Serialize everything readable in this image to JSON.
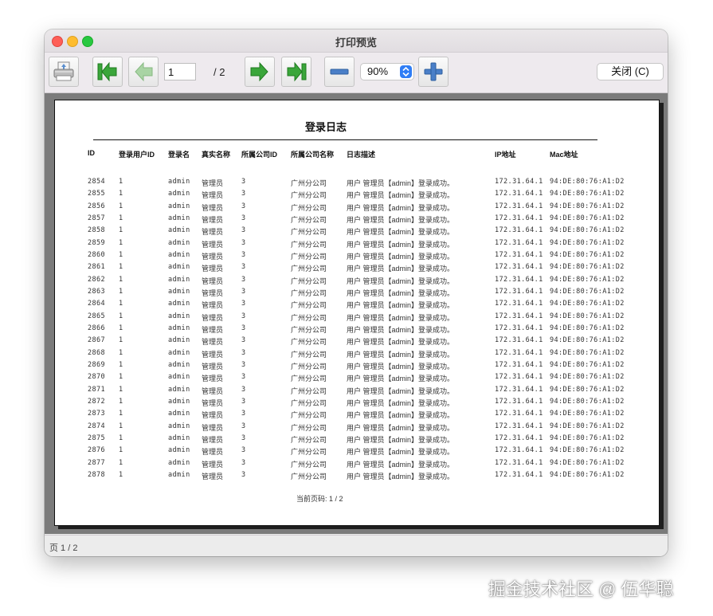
{
  "window": {
    "title": "打印预览"
  },
  "toolbar": {
    "page_value": "1",
    "page_total": "/ 2",
    "zoom_value": "90%",
    "close_label": "关闭 (C)"
  },
  "status": {
    "text": "页 1 / 2"
  },
  "document": {
    "title": "登录日志",
    "columns": [
      "ID",
      "登录用户ID",
      "登录名",
      "真实名称",
      "所属公司ID",
      "所属公司名称",
      "日志描述",
      "IP地址",
      "Mac地址"
    ],
    "rows": [
      [
        "2854",
        "1",
        "admin",
        "管理员",
        "3",
        "广州分公司",
        "用户 管理员【admin】登录成功。",
        "172.31.64.1",
        "94:DE:80:76:A1:D2"
      ],
      [
        "2855",
        "1",
        "admin",
        "管理员",
        "3",
        "广州分公司",
        "用户 管理员【admin】登录成功。",
        "172.31.64.1",
        "94:DE:80:76:A1:D2"
      ],
      [
        "2856",
        "1",
        "admin",
        "管理员",
        "3",
        "广州分公司",
        "用户 管理员【admin】登录成功。",
        "172.31.64.1",
        "94:DE:80:76:A1:D2"
      ],
      [
        "2857",
        "1",
        "admin",
        "管理员",
        "3",
        "广州分公司",
        "用户 管理员【admin】登录成功。",
        "172.31.64.1",
        "94:DE:80:76:A1:D2"
      ],
      [
        "2858",
        "1",
        "admin",
        "管理员",
        "3",
        "广州分公司",
        "用户 管理员【admin】登录成功。",
        "172.31.64.1",
        "94:DE:80:76:A1:D2"
      ],
      [
        "2859",
        "1",
        "admin",
        "管理员",
        "3",
        "广州分公司",
        "用户 管理员【admin】登录成功。",
        "172.31.64.1",
        "94:DE:80:76:A1:D2"
      ],
      [
        "2860",
        "1",
        "admin",
        "管理员",
        "3",
        "广州分公司",
        "用户 管理员【admin】登录成功。",
        "172.31.64.1",
        "94:DE:80:76:A1:D2"
      ],
      [
        "2861",
        "1",
        "admin",
        "管理员",
        "3",
        "广州分公司",
        "用户 管理员【admin】登录成功。",
        "172.31.64.1",
        "94:DE:80:76:A1:D2"
      ],
      [
        "2862",
        "1",
        "admin",
        "管理员",
        "3",
        "广州分公司",
        "用户 管理员【admin】登录成功。",
        "172.31.64.1",
        "94:DE:80:76:A1:D2"
      ],
      [
        "2863",
        "1",
        "admin",
        "管理员",
        "3",
        "广州分公司",
        "用户 管理员【admin】登录成功。",
        "172.31.64.1",
        "94:DE:80:76:A1:D2"
      ],
      [
        "2864",
        "1",
        "admin",
        "管理员",
        "3",
        "广州分公司",
        "用户 管理员【admin】登录成功。",
        "172.31.64.1",
        "94:DE:80:76:A1:D2"
      ],
      [
        "2865",
        "1",
        "admin",
        "管理员",
        "3",
        "广州分公司",
        "用户 管理员【admin】登录成功。",
        "172.31.64.1",
        "94:DE:80:76:A1:D2"
      ],
      [
        "2866",
        "1",
        "admin",
        "管理员",
        "3",
        "广州分公司",
        "用户 管理员【admin】登录成功。",
        "172.31.64.1",
        "94:DE:80:76:A1:D2"
      ],
      [
        "2867",
        "1",
        "admin",
        "管理员",
        "3",
        "广州分公司",
        "用户 管理员【admin】登录成功。",
        "172.31.64.1",
        "94:DE:80:76:A1:D2"
      ],
      [
        "2868",
        "1",
        "admin",
        "管理员",
        "3",
        "广州分公司",
        "用户 管理员【admin】登录成功。",
        "172.31.64.1",
        "94:DE:80:76:A1:D2"
      ],
      [
        "2869",
        "1",
        "admin",
        "管理员",
        "3",
        "广州分公司",
        "用户 管理员【admin】登录成功。",
        "172.31.64.1",
        "94:DE:80:76:A1:D2"
      ],
      [
        "2870",
        "1",
        "admin",
        "管理员",
        "3",
        "广州分公司",
        "用户 管理员【admin】登录成功。",
        "172.31.64.1",
        "94:DE:80:76:A1:D2"
      ],
      [
        "2871",
        "1",
        "admin",
        "管理员",
        "3",
        "广州分公司",
        "用户 管理员【admin】登录成功。",
        "172.31.64.1",
        "94:DE:80:76:A1:D2"
      ],
      [
        "2872",
        "1",
        "admin",
        "管理员",
        "3",
        "广州分公司",
        "用户 管理员【admin】登录成功。",
        "172.31.64.1",
        "94:DE:80:76:A1:D2"
      ],
      [
        "2873",
        "1",
        "admin",
        "管理员",
        "3",
        "广州分公司",
        "用户 管理员【admin】登录成功。",
        "172.31.64.1",
        "94:DE:80:76:A1:D2"
      ],
      [
        "2874",
        "1",
        "admin",
        "管理员",
        "3",
        "广州分公司",
        "用户 管理员【admin】登录成功。",
        "172.31.64.1",
        "94:DE:80:76:A1:D2"
      ],
      [
        "2875",
        "1",
        "admin",
        "管理员",
        "3",
        "广州分公司",
        "用户 管理员【admin】登录成功。",
        "172.31.64.1",
        "94:DE:80:76:A1:D2"
      ],
      [
        "2876",
        "1",
        "admin",
        "管理员",
        "3",
        "广州分公司",
        "用户 管理员【admin】登录成功。",
        "172.31.64.1",
        "94:DE:80:76:A1:D2"
      ],
      [
        "2877",
        "1",
        "admin",
        "管理员",
        "3",
        "广州分公司",
        "用户 管理员【admin】登录成功。",
        "172.31.64.1",
        "94:DE:80:76:A1:D2"
      ],
      [
        "2878",
        "1",
        "admin",
        "管理员",
        "3",
        "广州分公司",
        "用户 管理员【admin】登录成功。",
        "172.31.64.1",
        "94:DE:80:76:A1:D2"
      ]
    ],
    "footer": "当前页码: 1 / 2"
  },
  "watermark": "掘金技术社区 @ 伍华聪",
  "icons": {
    "print": "printer-icon",
    "first": "first-page-icon",
    "prev": "previous-page-icon",
    "next": "next-page-icon",
    "last": "last-page-icon",
    "zoom_out": "zoom-out-icon",
    "zoom_in": "zoom-in-icon"
  },
  "colors": {
    "nav_green": "#3aa63a",
    "nav_disabled": "#a9d4a4",
    "zoom_blue": "#4a7fc8",
    "select_accent": "#2f7df6"
  }
}
